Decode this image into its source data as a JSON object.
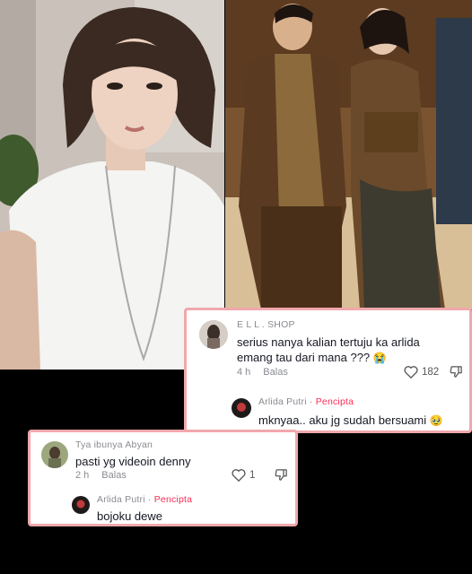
{
  "comment_main": {
    "username": "E L L . SHOP",
    "text_line1": "serius nanya kalian tertuju ka arlida",
    "text_line2": "emang tau dari mana ???",
    "emoji": "😭",
    "time": "4 h",
    "reply_label": "Balas",
    "likes": "182",
    "reply": {
      "username": "Arlida Putri",
      "separator": " · ",
      "badge": "Pencipta",
      "text": "mknyaa.. aku jg sudah bersuami",
      "emoji": "🥹"
    }
  },
  "comment_second": {
    "username": "Tya ibunya Abyan",
    "text": "pasti yg videoin denny",
    "time": "2 h",
    "reply_label": "Balas",
    "likes": "1",
    "reply": {
      "username": "Arlida Putri",
      "separator": " · ",
      "badge": "Pencipta",
      "text": "bojoku dewe"
    }
  },
  "colors": {
    "card_border": "#f0a8ad",
    "creator_badge": "#fe2c55",
    "muted_text": "#8a8b91",
    "body_text": "#161823"
  }
}
